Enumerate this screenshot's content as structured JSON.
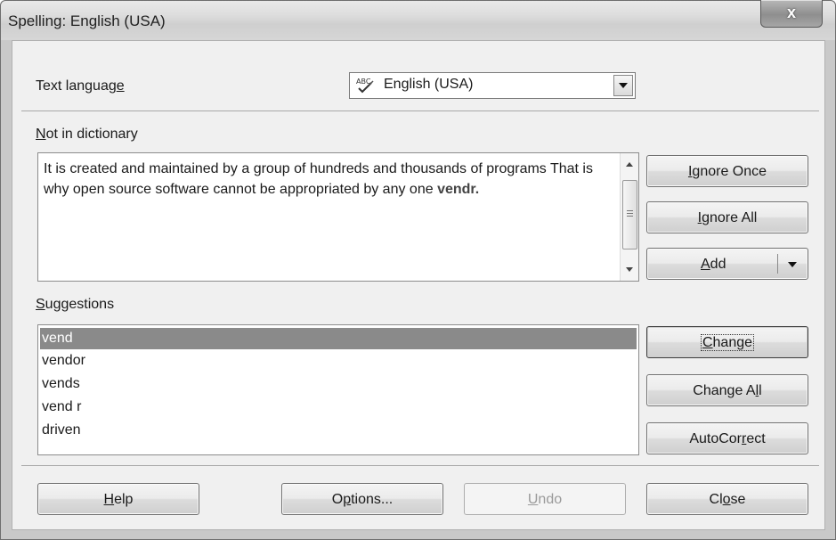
{
  "window": {
    "title": "Spelling: English (USA)",
    "close_label": "x"
  },
  "language": {
    "label_pre": "Text languag",
    "label_accel": "e",
    "value": "English (USA)"
  },
  "not_in_dictionary": {
    "label_accel": "N",
    "label_rest": "ot in dictionary",
    "text_before": "It is created and maintained by a group of hundreds and thousands of programs That is why open source software cannot be appropriated by any one ",
    "error_word": "vendr."
  },
  "suggestions": {
    "label_accel": "S",
    "label_rest": "uggestions",
    "items": [
      "vend",
      "vendor",
      "vends",
      "vend r",
      "driven"
    ],
    "selected": "vend"
  },
  "side_buttons": {
    "ignore_once": {
      "accel": "I",
      "rest": "gnore Once"
    },
    "ignore_all": {
      "accel": "I",
      "rest": "gnore All"
    },
    "add": {
      "accel": "A",
      "rest": "dd"
    },
    "change": {
      "accel": "C",
      "rest": "hange"
    },
    "change_all": {
      "pre": "Change A",
      "accel": "l",
      "rest": "l"
    },
    "autocorrect": {
      "pre": "AutoCor",
      "accel": "r",
      "rest": "ect"
    }
  },
  "bottom_buttons": {
    "help": {
      "accel": "H",
      "rest": "elp"
    },
    "options": {
      "pre": "O",
      "accel": "p",
      "rest": "tions..."
    },
    "undo": {
      "accel": "U",
      "rest": "ndo"
    },
    "close": {
      "pre": "Cl",
      "accel": "o",
      "rest": "se"
    }
  }
}
